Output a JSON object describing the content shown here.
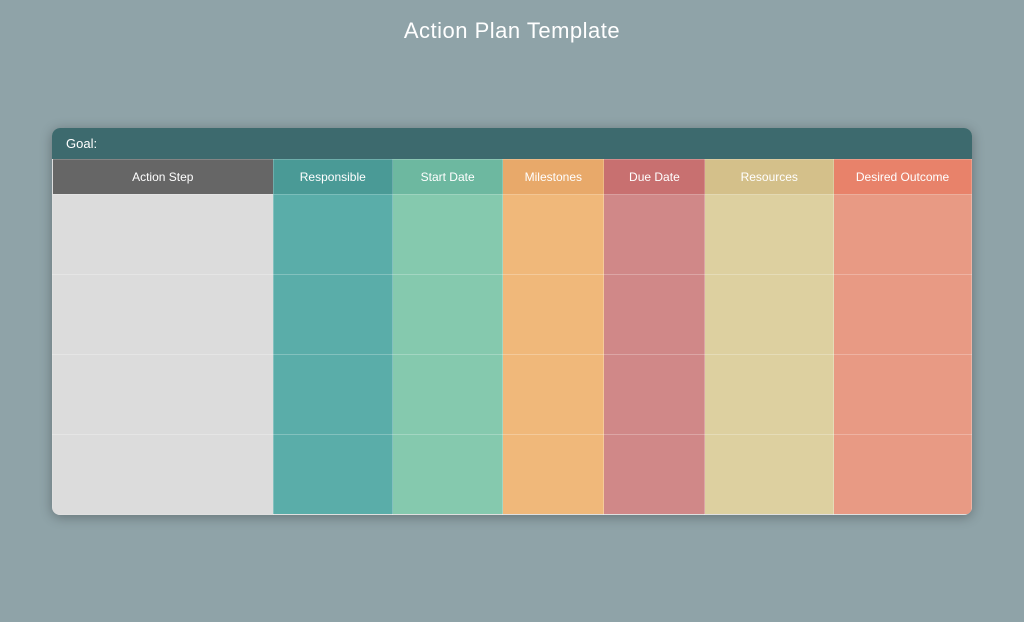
{
  "title": "Action Plan Template",
  "goal_label": "Goal:",
  "columns": {
    "action_step": "Action Step",
    "responsible": "Responsible",
    "start_date": "Start Date",
    "milestones": "Milestones",
    "due_date": "Due Date",
    "resources": "Resources",
    "desired_outcome": "Desired Outcome"
  },
  "rows": [
    {
      "id": 1
    },
    {
      "id": 2
    },
    {
      "id": 3
    },
    {
      "id": 4
    }
  ]
}
